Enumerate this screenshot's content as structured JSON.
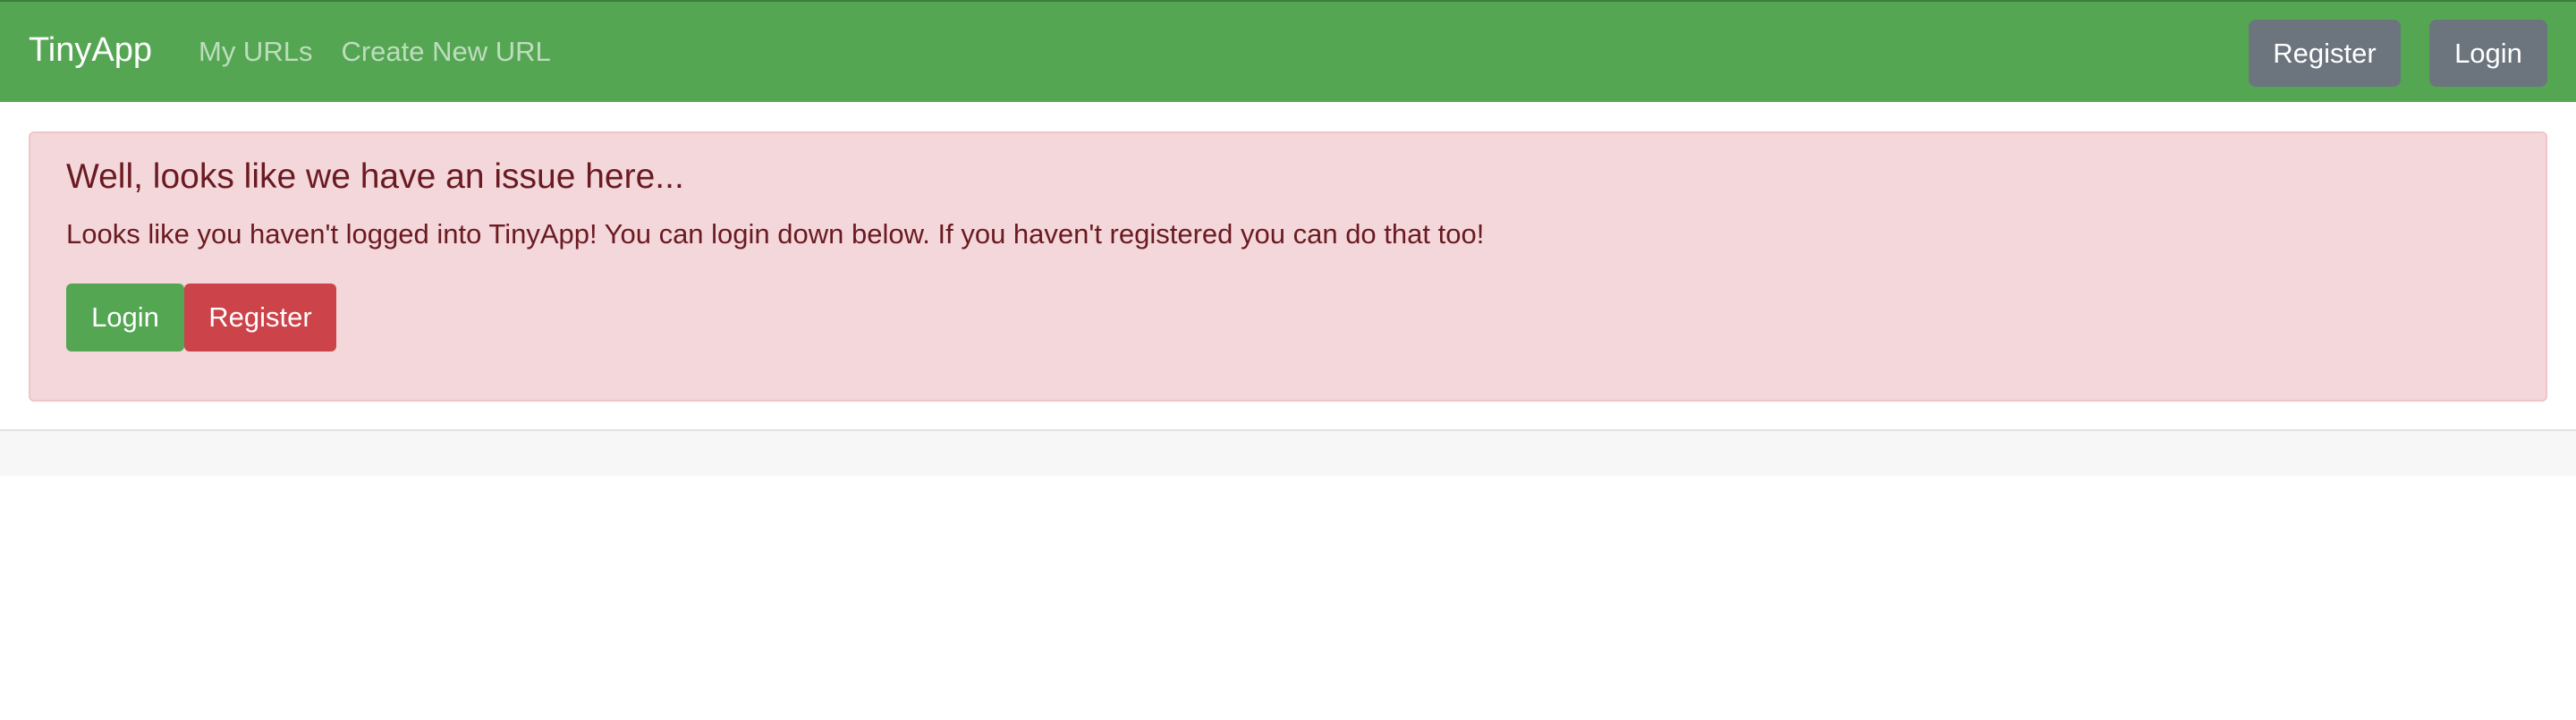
{
  "navbar": {
    "brand": "TinyApp",
    "links": [
      {
        "label": "My URLs"
      },
      {
        "label": "Create New URL"
      }
    ],
    "register_label": "Register",
    "login_label": "Login",
    "colors": {
      "background": "#54a653",
      "button": "#6c757d"
    }
  },
  "alert": {
    "heading": "Well, looks like we have an issue here...",
    "message": "Looks like you haven't logged into TinyApp! You can login down below. If you haven't registered you can do that too!",
    "login_label": "Login",
    "register_label": "Register",
    "colors": {
      "background": "#f4d7da",
      "text": "#6a1a21",
      "login_button": "#54a653",
      "register_button": "#cc434a"
    }
  }
}
